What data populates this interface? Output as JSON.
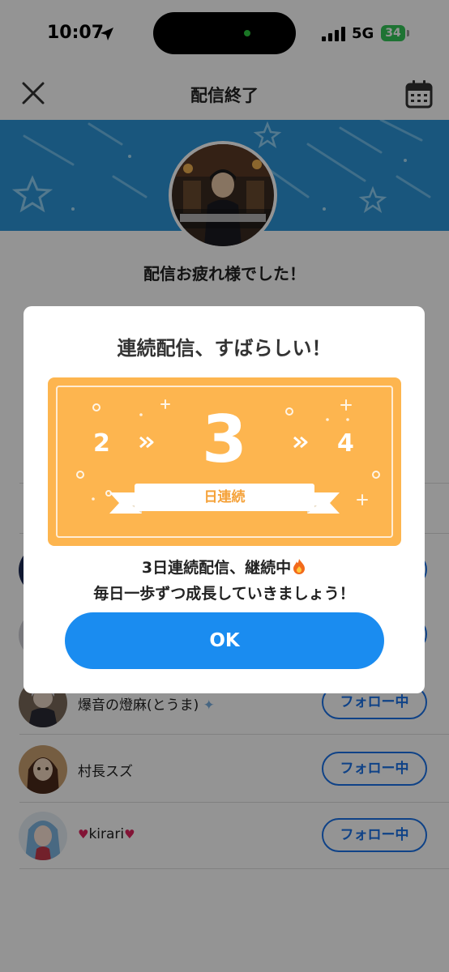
{
  "status_bar": {
    "time": "10:07",
    "network": "5G",
    "battery": "34"
  },
  "header": {
    "title": "配信終了"
  },
  "main": {
    "thanks": "配信お疲れ様でした！"
  },
  "followers": [
    {
      "name": "爆音の燈麻(とうま)",
      "button": "フォロー中"
    },
    {
      "name": "村長スズ",
      "button": "フォロー中"
    },
    {
      "name": "kirari",
      "button": "フォロー中"
    }
  ],
  "modal": {
    "title": "連続配信、すばらしい！",
    "streak": {
      "previous": "2",
      "current": "3",
      "next": "4",
      "label": "日連続"
    },
    "message_line1": "3日連続配信、継続中",
    "message_line2": "毎日一歩ずつ成長していきましょう！",
    "ok_label": "OK"
  },
  "colors": {
    "accent": "#1a8cf0",
    "streak_card": "#fdb54f",
    "banner": "#2c95d8",
    "follow": "#1a73e8"
  }
}
